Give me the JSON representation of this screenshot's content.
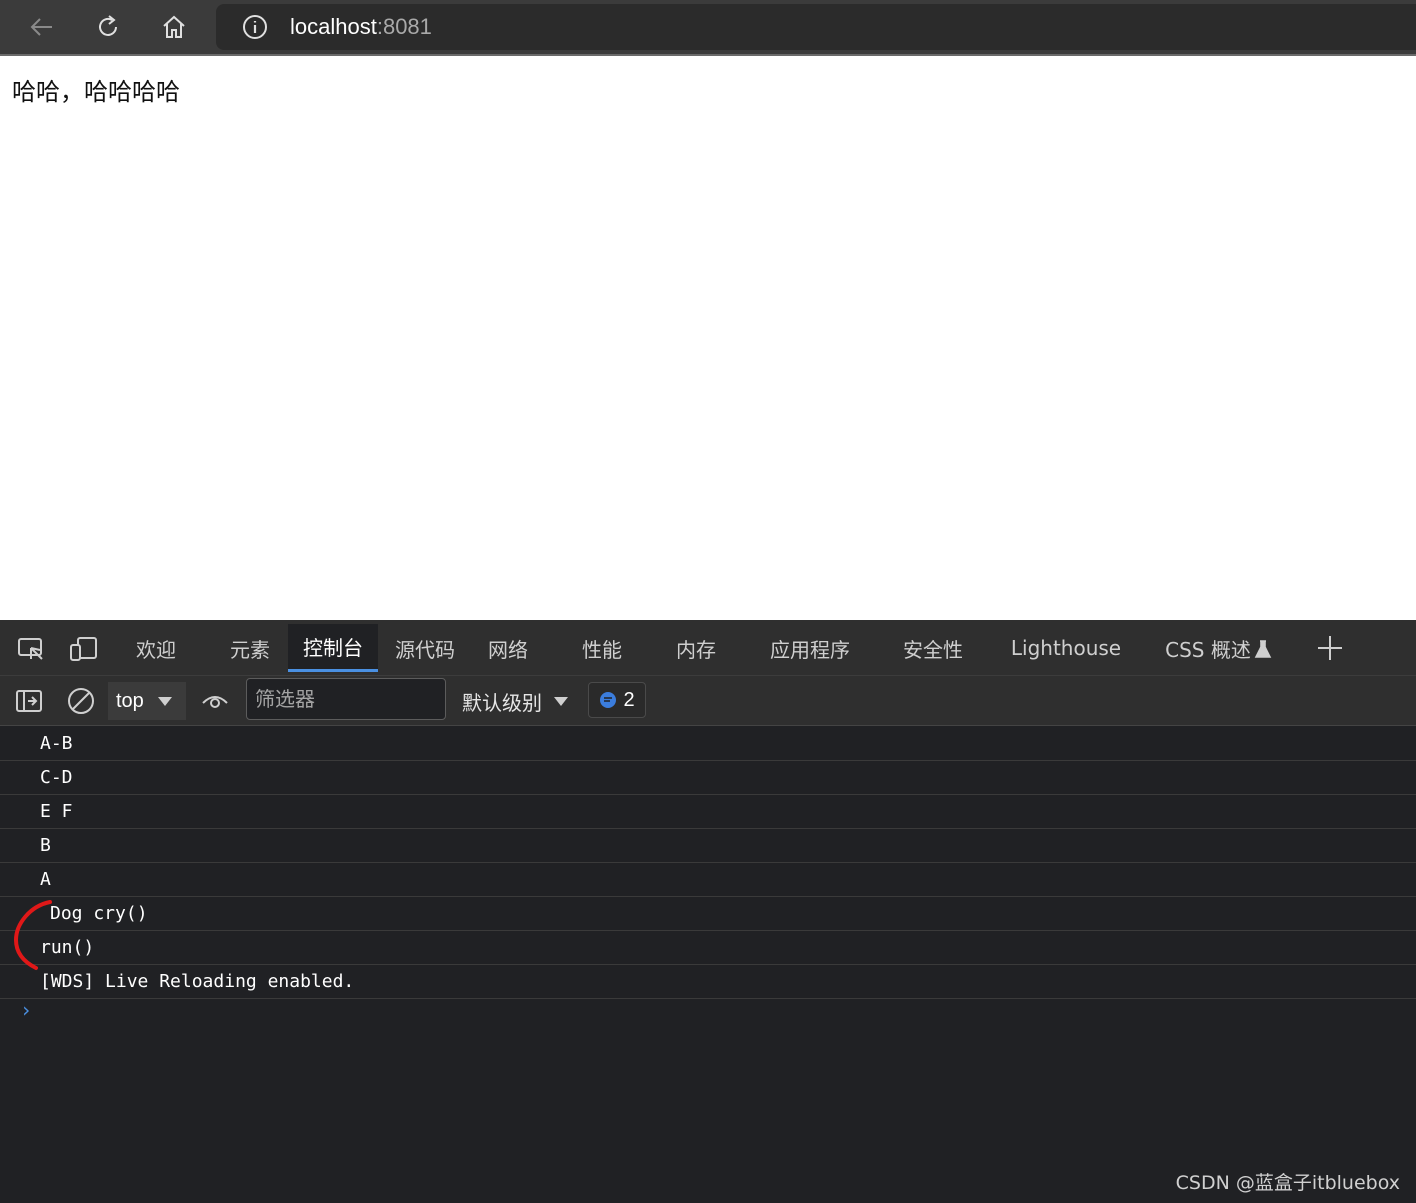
{
  "browser": {
    "address_host": "localhost",
    "address_port": ":8081",
    "icons": [
      "back-icon",
      "reload-icon",
      "home-icon",
      "info-icon"
    ]
  },
  "page": {
    "text": "哈哈，哈哈哈哈"
  },
  "devtools": {
    "tabs": [
      {
        "label": "欢迎"
      },
      {
        "label": "元素"
      },
      {
        "label": "控制台",
        "active": true
      },
      {
        "label": "源代码"
      },
      {
        "label": "网络"
      },
      {
        "label": "性能"
      },
      {
        "label": "内存"
      },
      {
        "label": "应用程序"
      },
      {
        "label": "安全性"
      },
      {
        "label": "Lighthouse"
      },
      {
        "label": "CSS 概述"
      }
    ],
    "toolbar": {
      "context": "top",
      "filter_placeholder": "筛选器",
      "level": "默认级别",
      "message_count": "2"
    },
    "console": {
      "rows": [
        "A-B",
        "C-D",
        "E F",
        "B",
        "A",
        "Dog cry()",
        "run()",
        "[WDS] Live Reloading enabled."
      ]
    },
    "accent_color": "#4a90e2"
  },
  "watermark": "CSDN @蓝盒子itbluebox"
}
